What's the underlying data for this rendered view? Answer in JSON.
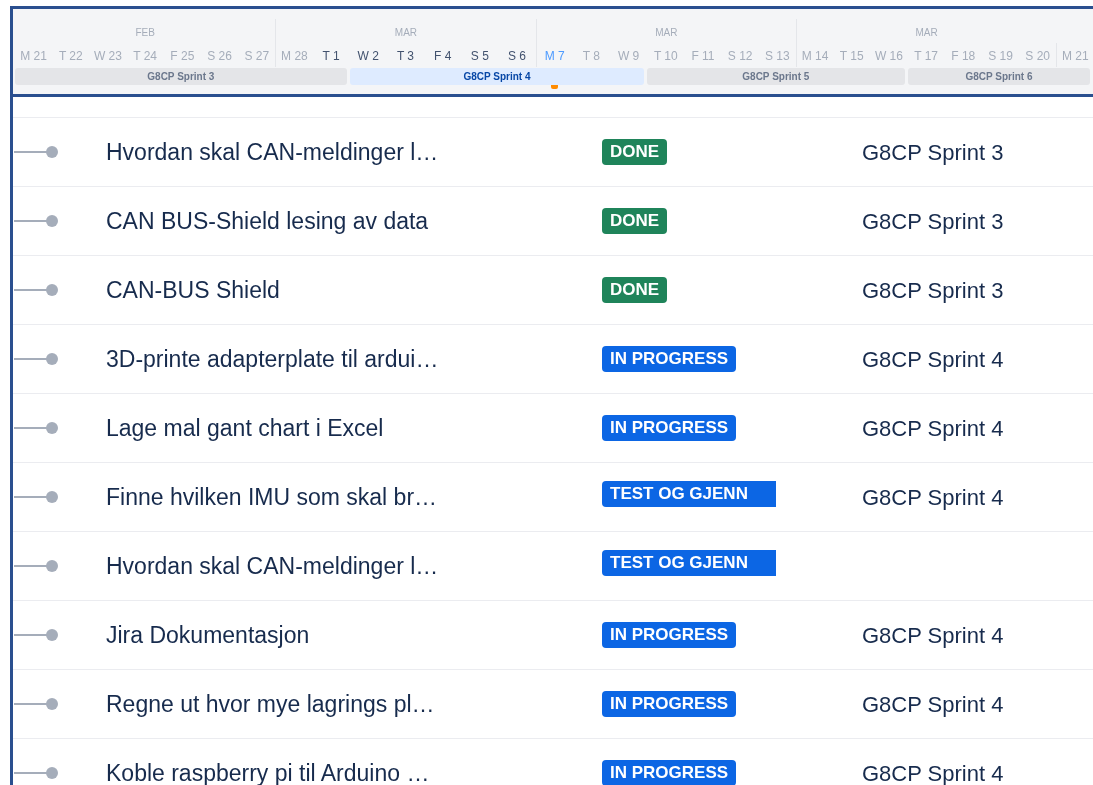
{
  "timeline": {
    "months": [
      "FEB",
      "MAR",
      "MAR",
      "MAR"
    ],
    "days": [
      {
        "label": "M 21",
        "dim": true,
        "today": false
      },
      {
        "label": "T 22",
        "dim": true,
        "today": false
      },
      {
        "label": "W 23",
        "dim": true,
        "today": false
      },
      {
        "label": "T 24",
        "dim": true,
        "today": false
      },
      {
        "label": "F 25",
        "dim": true,
        "today": false
      },
      {
        "label": "S 26",
        "dim": true,
        "today": false
      },
      {
        "label": "S 27",
        "dim": true,
        "today": false
      },
      {
        "label": "M 28",
        "dim": true,
        "today": false
      },
      {
        "label": "T 1",
        "dim": false,
        "today": false
      },
      {
        "label": "W 2",
        "dim": false,
        "today": false
      },
      {
        "label": "T 3",
        "dim": false,
        "today": false
      },
      {
        "label": "F 4",
        "dim": false,
        "today": false
      },
      {
        "label": "S 5",
        "dim": false,
        "today": false
      },
      {
        "label": "S 6",
        "dim": false,
        "today": false
      },
      {
        "label": "M 7",
        "dim": false,
        "today": true
      },
      {
        "label": "T 8",
        "dim": true,
        "today": false
      },
      {
        "label": "W 9",
        "dim": true,
        "today": false
      },
      {
        "label": "T 10",
        "dim": true,
        "today": false
      },
      {
        "label": "F 11",
        "dim": true,
        "today": false
      },
      {
        "label": "S 12",
        "dim": true,
        "today": false
      },
      {
        "label": "S 13",
        "dim": true,
        "today": false
      },
      {
        "label": "M 14",
        "dim": true,
        "today": false
      },
      {
        "label": "T 15",
        "dim": true,
        "today": false
      },
      {
        "label": "W 16",
        "dim": true,
        "today": false
      },
      {
        "label": "T 17",
        "dim": true,
        "today": false
      },
      {
        "label": "F 18",
        "dim": true,
        "today": false
      },
      {
        "label": "S 19",
        "dim": true,
        "today": false
      },
      {
        "label": "S 20",
        "dim": true,
        "today": false
      },
      {
        "label": "M 21",
        "dim": true,
        "today": false
      }
    ],
    "sprints": [
      {
        "name": "G8CP Sprint 3",
        "selected": false
      },
      {
        "name": "G8CP Sprint 4",
        "selected": true
      },
      {
        "name": "G8CP Sprint 5",
        "selected": false
      },
      {
        "name": "G8CP Sprint 6",
        "selected": false
      }
    ]
  },
  "issues": [
    {
      "title": "Hvordan skal CAN-meldinger l…",
      "status": "DONE",
      "kind": "done",
      "sprint": "G8CP Sprint 3"
    },
    {
      "title": "CAN BUS-Shield lesing av data",
      "status": "DONE",
      "kind": "done",
      "sprint": "G8CP Sprint 3"
    },
    {
      "title": "CAN-BUS Shield",
      "status": "DONE",
      "kind": "done",
      "sprint": "G8CP Sprint 3"
    },
    {
      "title": "3D-printe adapterplate til ardui…",
      "status": "IN PROGRESS",
      "kind": "progress",
      "sprint": "G8CP Sprint 4"
    },
    {
      "title": "Lage mal gant chart i Excel",
      "status": "IN PROGRESS",
      "kind": "progress",
      "sprint": "G8CP Sprint 4"
    },
    {
      "title": "Finne hvilken IMU som skal br…",
      "status": "TEST OG GJENN",
      "kind": "cut",
      "sprint": "G8CP Sprint 4"
    },
    {
      "title": "Hvordan skal CAN-meldinger l…",
      "status": "TEST OG GJENN",
      "kind": "cut"
    },
    {
      "title": "Jira Dokumentasjon",
      "status": "IN PROGRESS",
      "kind": "progress",
      "sprint": "G8CP Sprint 4"
    },
    {
      "title": "Regne ut hvor mye lagrings pl…",
      "status": "IN PROGRESS",
      "kind": "progress",
      "sprint": "G8CP Sprint 4"
    },
    {
      "title": "Koble raspberry pi til Arduino …",
      "status": "IN PROGRESS",
      "kind": "progress",
      "sprint": "G8CP Sprint 4"
    }
  ]
}
